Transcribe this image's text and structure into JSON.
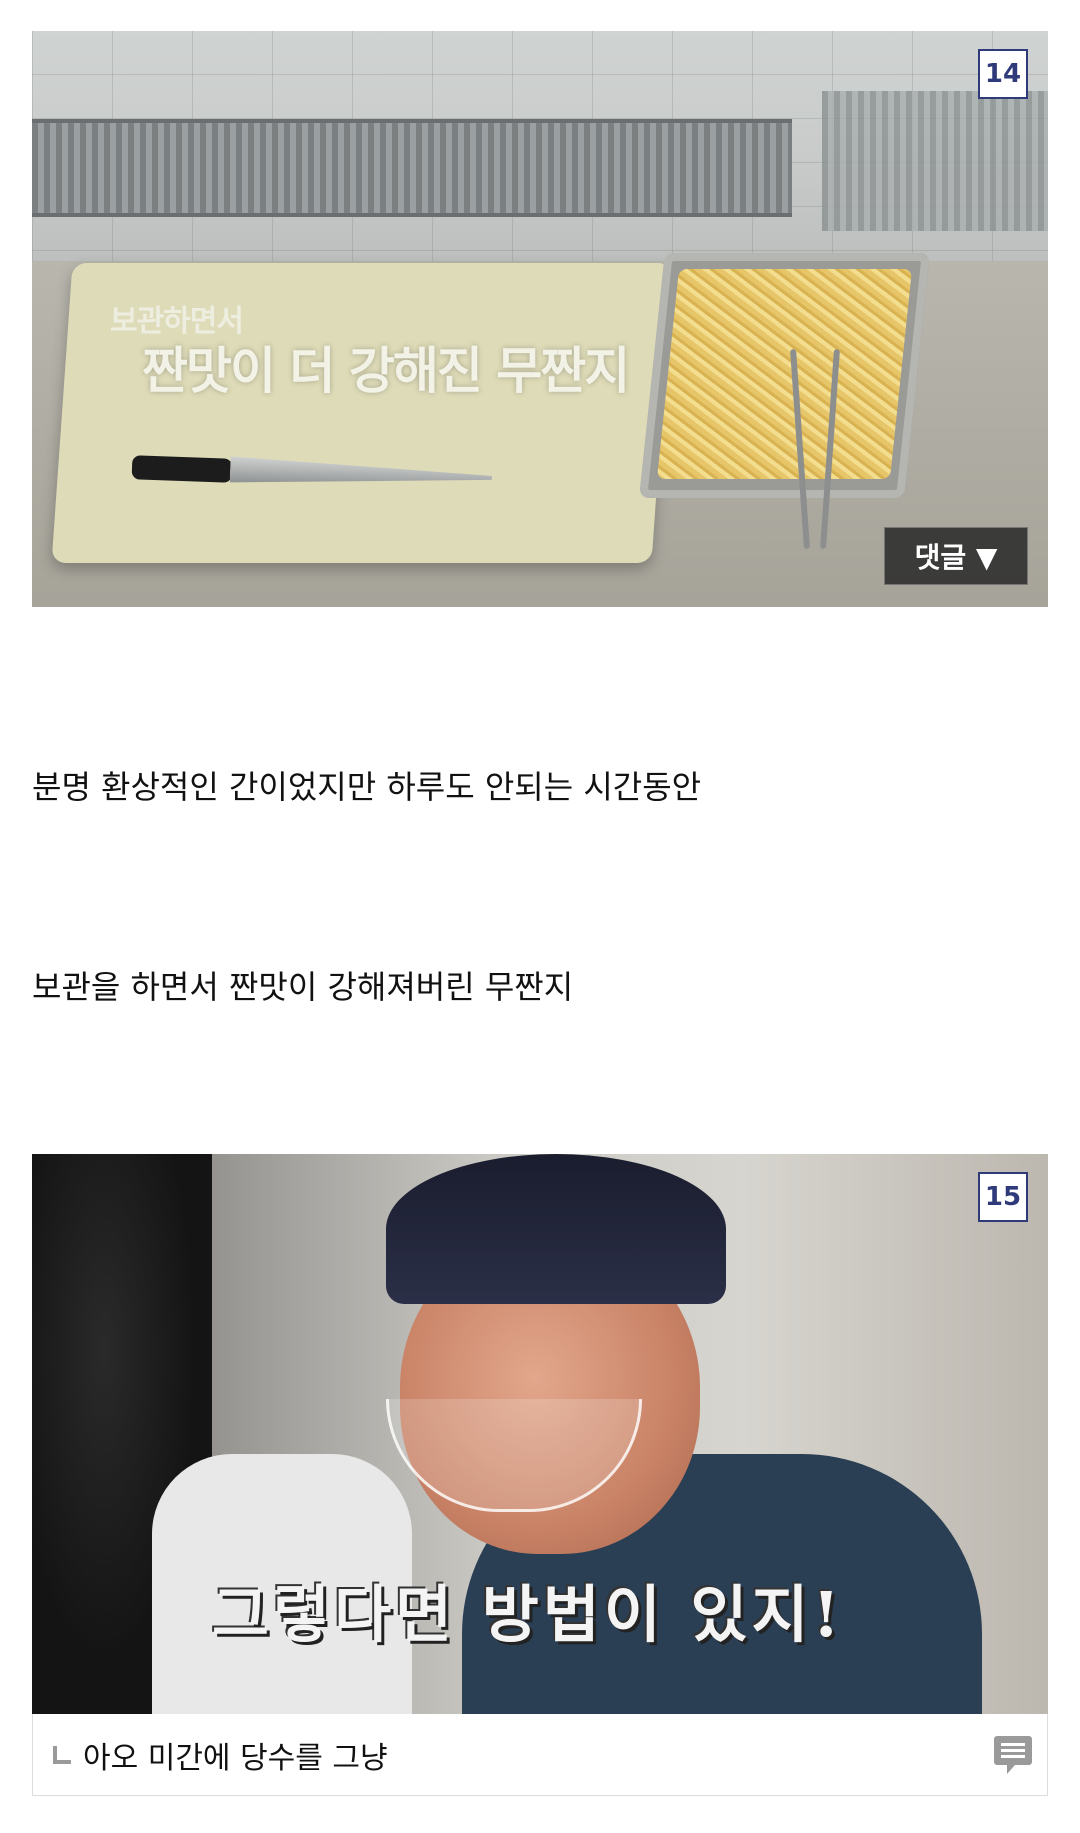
{
  "images": [
    {
      "badge": "14",
      "overlay_line1": "보관하면서",
      "overlay_line2": "짠맛이 더 강해진 무짠지",
      "comment_button": "댓글 ▼"
    },
    {
      "badge": "15",
      "overlay_line1": "그렇다면 방법이 있지!"
    }
  ],
  "paragraphs": [
    "분명 환상적인 간이었지만 하루도 안되는 시간동안",
    "보관을 하면서 짠맛이 강해져버린 무짠지"
  ],
  "caption": {
    "text": "아오 미간에 당수를 그냥",
    "icon": "comment-list-icon"
  },
  "colors": {
    "badge_border": "#2f3a7a",
    "badge_text": "#2f3a7a",
    "comment_button_bg": "#282828"
  }
}
